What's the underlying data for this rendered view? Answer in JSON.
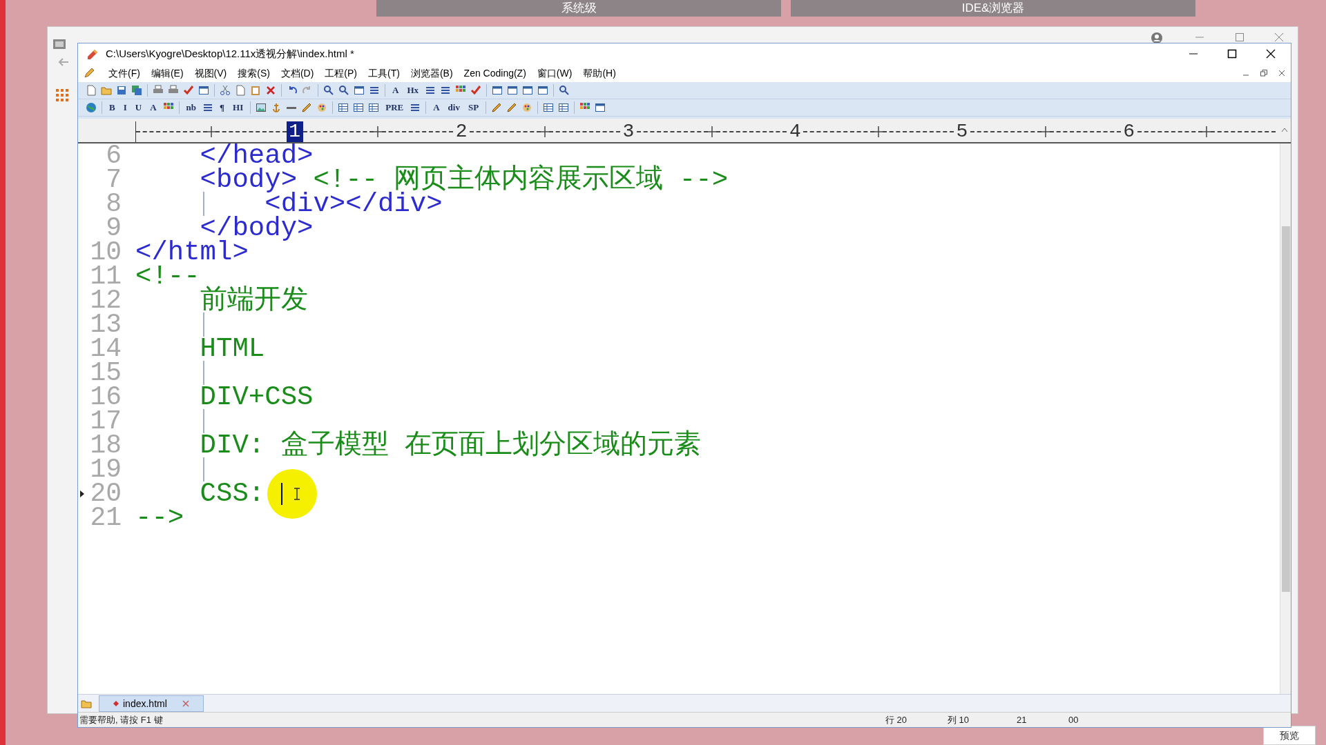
{
  "desktop_tabs": [
    {
      "label": "系统级"
    },
    {
      "label": "IDE&浏览器"
    }
  ],
  "window": {
    "title": "C:\\Users\\Kyogre\\Desktop\\12.11x透视分解\\index.html *"
  },
  "menu": [
    "文件(F)",
    "编辑(E)",
    "视图(V)",
    "搜索(S)",
    "文档(D)",
    "工程(P)",
    "工具(T)",
    "浏览器(B)",
    "Zen Coding(Z)",
    "窗口(W)",
    "帮助(H)"
  ],
  "main_toolbar_labels": [
    "A",
    "Hx"
  ],
  "format_toolbar_labels": [
    "B",
    "I",
    "U",
    "A",
    "nb",
    "¶",
    "HI",
    "PRE",
    "A",
    "div",
    "SP"
  ],
  "ruler": {
    "marks": [
      {
        "label": "1",
        "selected": true
      },
      {
        "label": "2",
        "selected": false
      },
      {
        "label": "3",
        "selected": false
      },
      {
        "label": "4",
        "selected": false
      },
      {
        "label": "5",
        "selected": false
      },
      {
        "label": "6",
        "selected": false
      }
    ]
  },
  "lines": [
    {
      "number": "6",
      "segments": [
        {
          "text": "    </head>",
          "kind": "tag"
        }
      ],
      "indent_guide": false,
      "current": false
    },
    {
      "number": "7",
      "segments": [
        {
          "text": "    <body>",
          "kind": "tag"
        },
        {
          "text": " <!-- 网页主体内容展示区域 -->",
          "kind": "comment"
        }
      ],
      "indent_guide": false,
      "current": false
    },
    {
      "number": "8",
      "segments": [
        {
          "text": "        <div></div>",
          "kind": "tag"
        }
      ],
      "indent_guide": true,
      "current": false
    },
    {
      "number": "9",
      "segments": [
        {
          "text": "    </body>",
          "kind": "tag"
        }
      ],
      "indent_guide": false,
      "current": false
    },
    {
      "number": "10",
      "segments": [
        {
          "text": "</html>",
          "kind": "tag"
        }
      ],
      "indent_guide": false,
      "current": false
    },
    {
      "number": "11",
      "segments": [
        {
          "text": "<!--",
          "kind": "comment"
        }
      ],
      "indent_guide": false,
      "current": false
    },
    {
      "number": "12",
      "segments": [
        {
          "text": "    前端开发",
          "kind": "comment"
        }
      ],
      "indent_guide": false,
      "current": false
    },
    {
      "number": "13",
      "indent_guide": true,
      "current": false
    },
    {
      "number": "14",
      "segments": [
        {
          "text": "    HTML",
          "kind": "comment"
        }
      ],
      "indent_guide": false,
      "current": false
    },
    {
      "number": "15",
      "indent_guide": true,
      "current": false
    },
    {
      "number": "16",
      "segments": [
        {
          "text": "    DIV+CSS",
          "kind": "comment"
        }
      ],
      "indent_guide": false,
      "current": false
    },
    {
      "number": "17",
      "indent_guide": true,
      "current": false
    },
    {
      "number": "18",
      "segments": [
        {
          "text": "    DIV: 盒子模型 在页面上划分区域的元素",
          "kind": "comment"
        }
      ],
      "indent_guide": false,
      "current": false
    },
    {
      "number": "19",
      "indent_guide": true,
      "current": false
    },
    {
      "number": "20",
      "segments": [
        {
          "text": "    CSS: ",
          "kind": "comment"
        }
      ],
      "indent_guide": false,
      "current": true
    },
    {
      "number": "21",
      "segments": [
        {
          "text": "-->",
          "kind": "comment"
        }
      ],
      "indent_guide": false,
      "current": false
    }
  ],
  "document_tabs": [
    {
      "label": "index.html",
      "selected": true
    }
  ],
  "status_bar": {
    "help": "需要帮助, 请按 F1 键",
    "line": "行 20",
    "column": "列 10",
    "lines_total": "21",
    "code": "00"
  },
  "preview_button": "预览"
}
